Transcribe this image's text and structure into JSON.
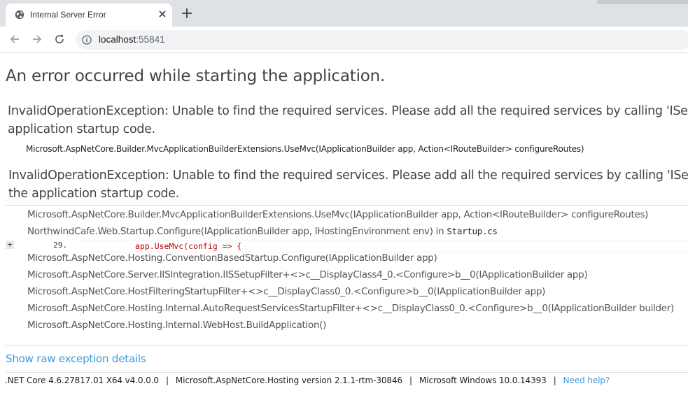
{
  "browser": {
    "tab_title": "Internal Server Error",
    "url_host": "localhost",
    "url_port": ":55841"
  },
  "page": {
    "title": "An error occurred while starting the application.",
    "exception_1": {
      "line1": "InvalidOperationException: Unable to find the required services. Please add all the required services by calling 'IServiceC",
      "line2": "application startup code.",
      "frame": "Microsoft.AspNetCore.Builder.MvcApplicationBuilderExtensions.UseMvc(IApplicationBuilder app, Action<IRouteBuilder> configureRoutes)"
    },
    "exception_2": {
      "line1": "InvalidOperationException: Unable to find the required services. Please add all the required services by calling 'IServiceC",
      "line2": "the application startup code."
    },
    "stack": {
      "frames": [
        "Microsoft.AspNetCore.Builder.MvcApplicationBuilderExtensions.UseMvc(IApplicationBuilder app, Action<IRouteBuilder> configureRoutes)",
        "NorthwindCafe.Web.Startup.Configure(IApplicationBuilder app, IHostingEnvironment env) in ",
        "Microsoft.AspNetCore.Hosting.ConventionBasedStartup.Configure(IApplicationBuilder app)",
        "Microsoft.AspNetCore.Server.IISIntegration.IISSetupFilter+<>c__DisplayClass4_0.<Configure>b__0(IApplicationBuilder app)",
        "Microsoft.AspNetCore.HostFilteringStartupFilter+<>c__DisplayClass0_0.<Configure>b__0(IApplicationBuilder app)",
        "Microsoft.AspNetCore.Hosting.Internal.AutoRequestServicesStartupFilter+<>c__DisplayClass0_0.<Configure>b__0(IApplicationBuilder builder)",
        "Microsoft.AspNetCore.Hosting.Internal.WebHost.BuildApplication()"
      ],
      "source_file": "Startup.cs",
      "expander": "+",
      "line_number": "29.",
      "code_line": "app.UseMvc(config => {"
    },
    "raw_link": "Show raw exception details",
    "footer": {
      "runtime": ".NET Core 4.6.27817.01 X64 v4.0.0.0",
      "hosting": "Microsoft.AspNetCore.Hosting version 2.1.1-rtm-30846",
      "os": "Microsoft Windows 10.0.14393",
      "separator": "|",
      "help": "Need help?"
    }
  },
  "colors": {
    "link": "#3a9dd9",
    "code_highlight": "#c00000",
    "tabstrip": "#dee1e6"
  },
  "icons": [
    "globe-icon",
    "close-icon",
    "plus-icon",
    "back-arrow-icon",
    "forward-arrow-icon",
    "reload-icon",
    "info-icon"
  ]
}
